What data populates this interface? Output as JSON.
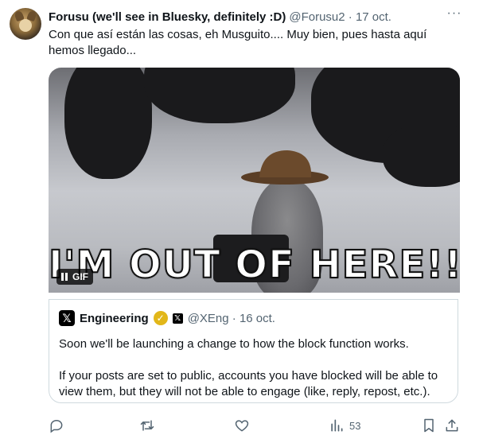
{
  "tweet": {
    "author_name": "Forusu (we'll see in Bluesky, definitely :D)",
    "handle_date": "@Forusu2 · 17 oct.",
    "text": "Con que así están las cosas, eh Musguito.... Muy bien, pues hasta aquí hemos llegado...",
    "more_icon": "···"
  },
  "media": {
    "caption": "I'M OUT OF HERE!!!",
    "badge_label": "GIF"
  },
  "quote": {
    "name": "Engineering",
    "handle_date": "@XEng · 16 oct.",
    "logo": "𝕏",
    "paragraphs": [
      "Soon we'll be launching a change to how the block function works.",
      "If your posts are set to public, accounts you have blocked will be able to view them, but they will not be able to engage (like, reply, repost, etc.)."
    ]
  },
  "actions": {
    "views": "53"
  },
  "colors": {
    "text": "#0f1419",
    "secondary": "#536471",
    "border": "#cfd9de",
    "verified": "#e2b719"
  }
}
